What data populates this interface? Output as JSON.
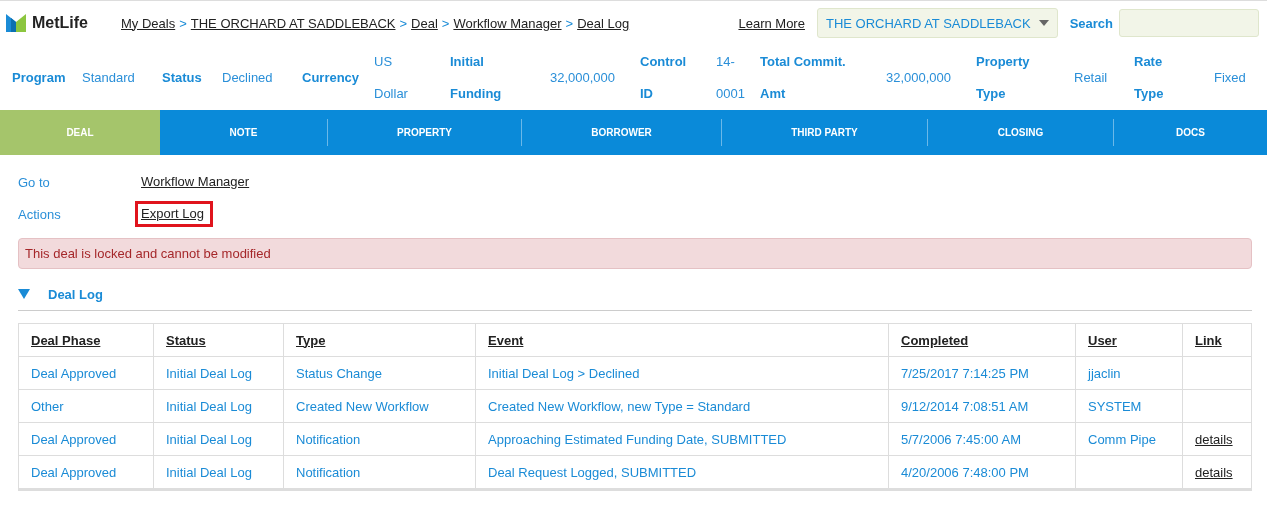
{
  "header": {
    "logo": "MetLife",
    "breadcrumbs": [
      "My Deals",
      "THE ORCHARD AT SADDLEBACK",
      "Deal",
      "Workflow Manager",
      "Deal Log"
    ],
    "separator": ">",
    "learn_more": "Learn More",
    "deal_select": "THE ORCHARD AT SADDLEBACK",
    "search": {
      "label": "Search"
    }
  },
  "summary": [
    {
      "label": "Program",
      "value": "Standard"
    },
    {
      "label": "Status",
      "value": "Declined"
    },
    {
      "label": "Currency",
      "value": "US\nDollar"
    },
    {
      "label": "Initial\nFunding",
      "value": "32,000,000"
    },
    {
      "label": "Control\nID",
      "value": "14-\n0001"
    },
    {
      "label": "Total Commit.\nAmt",
      "value": "32,000,000"
    },
    {
      "label": "Property\nType",
      "value": "Retail"
    },
    {
      "label": "Rate\nType",
      "value": "Fixed"
    }
  ],
  "tabs": [
    {
      "label": "DEAL",
      "selected": true
    },
    {
      "label": "NOTE",
      "selected": false
    },
    {
      "label": "PROPERTY",
      "selected": false
    },
    {
      "label": "BORROWER",
      "selected": false
    },
    {
      "label": "THIRD PARTY",
      "selected": false
    },
    {
      "label": "CLOSING",
      "selected": false
    },
    {
      "label": "DOCS",
      "selected": false
    }
  ],
  "links": [
    {
      "label": "Go to",
      "link": "Workflow Manager",
      "highlighted": false
    },
    {
      "label": "Actions",
      "link": "Export Log",
      "highlighted": true
    }
  ],
  "alert": "This deal is locked and cannot be modified",
  "section": {
    "title": "Deal Log",
    "expanded": true
  },
  "table": {
    "columns": [
      "Deal Phase",
      "Status",
      "Type",
      "Event",
      "Completed",
      "User",
      "Link"
    ],
    "rows": [
      [
        "Deal Approved",
        "Initial Deal Log",
        "Status Change",
        "Initial Deal Log > Declined",
        "7/25/2017 7:14:25 PM",
        "jjaclin",
        ""
      ],
      [
        "Other",
        "Initial Deal Log",
        "Created New Workflow",
        "Created New Workflow, new Type = Standard",
        "9/12/2014 7:08:51 AM",
        "SYSTEM",
        ""
      ],
      [
        "Deal Approved",
        "Initial Deal Log",
        "Notification",
        "Approaching Estimated Funding Date, SUBMITTED",
        "5/7/2006 7:45:00 AM",
        "Comm Pipe",
        "details"
      ],
      [
        "Deal Approved",
        "Initial Deal Log",
        "Notification",
        "Deal Request Logged, SUBMITTED",
        "4/20/2006 7:48:00 PM",
        "",
        "details"
      ]
    ]
  }
}
